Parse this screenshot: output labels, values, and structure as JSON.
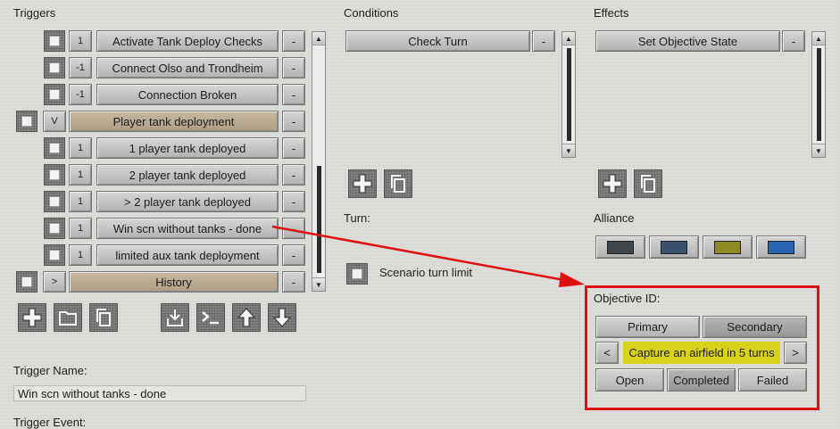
{
  "triggers": {
    "header": "Triggers",
    "rows": [
      {
        "count": "1",
        "label": "Activate Tank Deploy Checks",
        "style": "normal",
        "indent": true
      },
      {
        "count": "-1",
        "label": "Connect Olso and Trondheim",
        "style": "normal",
        "indent": true
      },
      {
        "count": "-1",
        "label": "Connection Broken",
        "style": "normal",
        "indent": true
      },
      {
        "count": "V",
        "label": "Player tank deployment",
        "style": "tan",
        "indent": false
      },
      {
        "count": "1",
        "label": "1 player tank deployed",
        "style": "normal",
        "indent": true
      },
      {
        "count": "1",
        "label": "2 player tank deployed",
        "style": "normal",
        "indent": true
      },
      {
        "count": "1",
        "label": "> 2 player tank deployed",
        "style": "normal",
        "indent": true
      },
      {
        "count": "1",
        "label": "Win scn without tanks - done",
        "style": "normal",
        "indent": true
      },
      {
        "count": "1",
        "label": "limited aux tank deployment",
        "style": "normal",
        "indent": true
      },
      {
        "count": ">",
        "label": "History",
        "style": "tan",
        "indent": false
      }
    ],
    "remove_label": "-",
    "toolbar_icons": [
      "plus-icon",
      "folder-icon",
      "copy-icon",
      "import-icon",
      "console-icon",
      "arrow-up-icon",
      "arrow-down-icon"
    ],
    "name_label": "Trigger Name:",
    "name_value": "Win scn without tanks - done",
    "event_label": "Trigger Event:"
  },
  "conditions": {
    "header": "Conditions",
    "items": [
      {
        "label": "Check Turn"
      }
    ],
    "remove_label": "-",
    "turn_label": "Turn:",
    "turn_limit_label": "Scenario turn limit"
  },
  "effects": {
    "header": "Effects",
    "items": [
      {
        "label": "Set Objective State"
      }
    ],
    "remove_label": "-",
    "alliance_label": "Alliance",
    "alliance_colors": [
      "#3f4549",
      "#3a5270",
      "#8c8a22",
      "#2a64b4"
    ]
  },
  "objective": {
    "label": "Objective ID:",
    "tab_primary": "Primary",
    "tab_secondary": "Secondary",
    "prev": "<",
    "next": ">",
    "value": "Capture an airfield in 5 turns",
    "state_open": "Open",
    "state_completed": "Completed",
    "state_failed": "Failed"
  },
  "annotation": {
    "color": "#e01010"
  }
}
